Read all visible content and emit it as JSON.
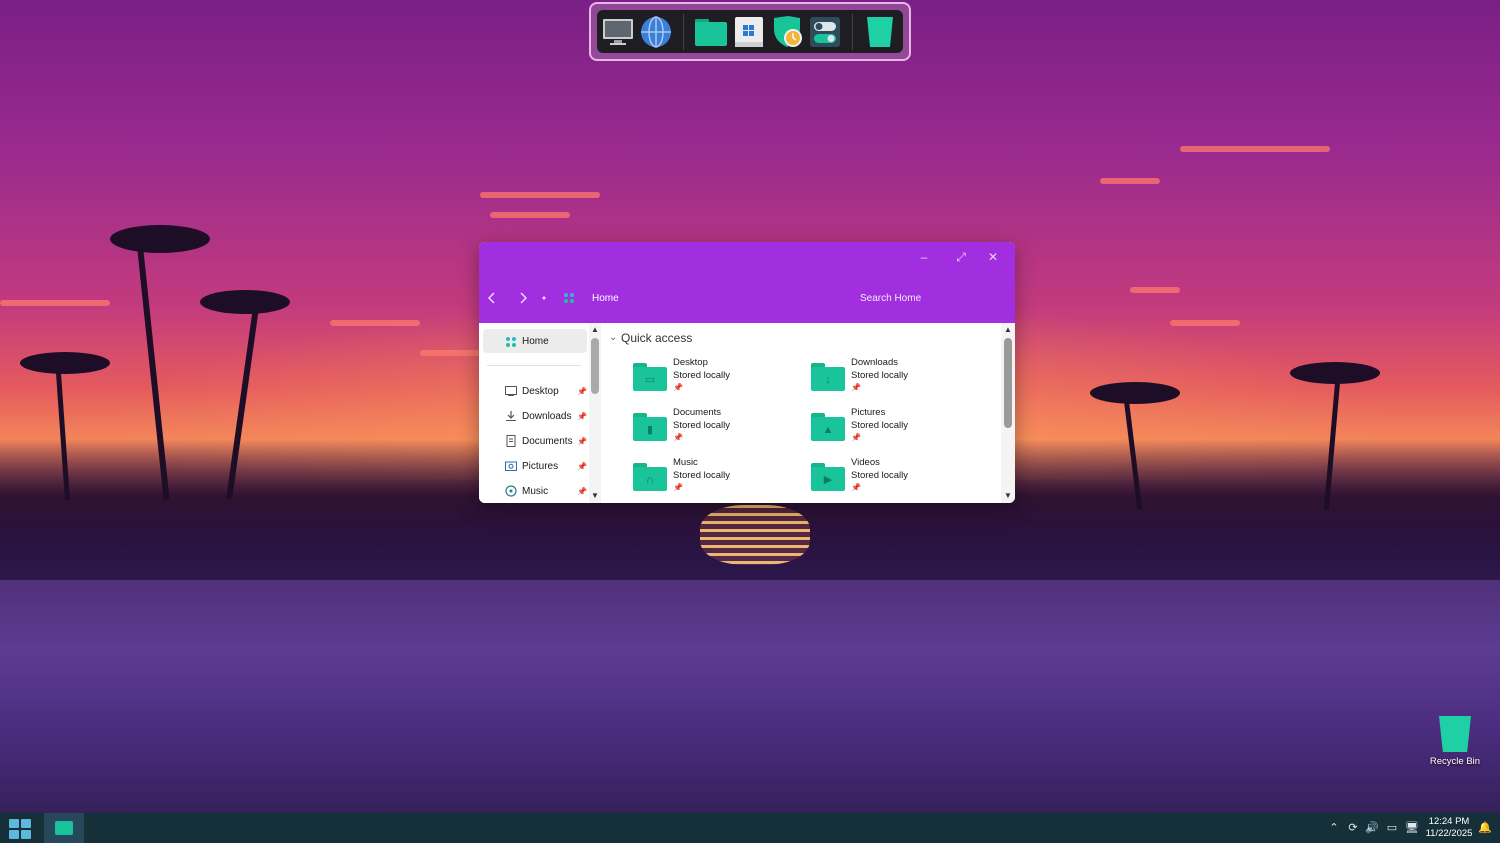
{
  "dock": {
    "icons": [
      "monitor-icon",
      "globe-icon",
      "folder-icon",
      "windows-store-icon",
      "shield-clock-icon",
      "toggles-icon",
      "recycle-bin-icon"
    ]
  },
  "window": {
    "breadcrumb": "Home",
    "search_placeholder": "Search Home",
    "controls": {
      "minimize": "–",
      "maximize": "⤢",
      "close": "✕"
    },
    "sidebar": {
      "home": "Home",
      "items": [
        {
          "label": "Desktop",
          "icon": "desktop-icon"
        },
        {
          "label": "Downloads",
          "icon": "download-icon"
        },
        {
          "label": "Documents",
          "icon": "document-icon"
        },
        {
          "label": "Pictures",
          "icon": "pictures-icon"
        },
        {
          "label": "Music",
          "icon": "music-icon"
        }
      ]
    },
    "section_title": "Quick access",
    "tiles": [
      {
        "name": "Desktop",
        "sub": "Stored locally"
      },
      {
        "name": "Downloads",
        "sub": "Stored locally"
      },
      {
        "name": "Documents",
        "sub": "Stored locally"
      },
      {
        "name": "Pictures",
        "sub": "Stored locally"
      },
      {
        "name": "Music",
        "sub": "Stored locally"
      },
      {
        "name": "Videos",
        "sub": "Stored locally"
      }
    ]
  },
  "desktop": {
    "recycle_bin": "Recycle Bin"
  },
  "taskbar": {
    "time": "12:24 PM",
    "date": "11/22/2025"
  },
  "colors": {
    "titlebar": "#a12fe0",
    "accent_folder": "#1ac49a",
    "taskbar": "#16303a"
  }
}
